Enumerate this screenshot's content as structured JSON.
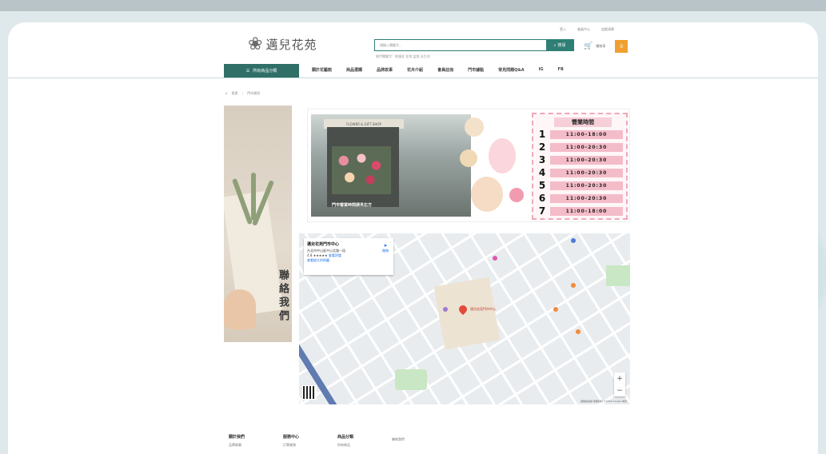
{
  "header": {
    "util_links": [
      "登入",
      "會員中心",
      "追蹤清單"
    ],
    "brand_name": "邁兒花苑",
    "search": {
      "placeholder": "請輸入關鍵字...",
      "button_label": "搜尋"
    },
    "hot_keywords": "熱門關鍵字：乾燥花 花束 盆栽 永生花",
    "cart": {
      "label": "購物車",
      "count": "0"
    }
  },
  "nav": {
    "category_button": "所有商品分類",
    "items": [
      "關於花藝館",
      "商品選購",
      "品牌故事",
      "花卉介紹",
      "會員註冊",
      "門市據點",
      "常見問題Q&A",
      "IG",
      "FB"
    ]
  },
  "breadcrumb": [
    "首頁",
    "門市資訊"
  ],
  "sidebanner": {
    "vertical_text": "聯絡我們"
  },
  "hours_banner": {
    "shop_sign": "FLOWER & GIFT SHOP",
    "caption": "門市營業時間請見右方",
    "title": "營業時間",
    "rows": [
      {
        "day": "1",
        "time": "11:00-18:00"
      },
      {
        "day": "2",
        "time": "11:00-20:30"
      },
      {
        "day": "3",
        "time": "11:00-20:30"
      },
      {
        "day": "4",
        "time": "11:00-20:30"
      },
      {
        "day": "5",
        "time": "11:00-20:30"
      },
      {
        "day": "6",
        "time": "11:00-20:30"
      },
      {
        "day": "7",
        "time": "11:00-18:00"
      }
    ]
  },
  "map": {
    "info_title": "邁兒花苑門市中心",
    "info_address": "台北市中山區中山北路一段",
    "info_rating": "4.8 ★★★★★",
    "info_reviews": "查看評論",
    "info_link": "查看放大的地圖",
    "directions_label": "路線",
    "pin_label": "邁兒花苑門市中心",
    "zoom_in": "+",
    "zoom_out": "−",
    "attribution": "鍵盤快速鍵 地圖資料 ©2024 Google 條款"
  },
  "footer": {
    "columns": [
      {
        "heading": "關於我們",
        "item": "品牌故事"
      },
      {
        "heading": "服務中心",
        "item": "訂單查詢"
      },
      {
        "heading": "商品分類",
        "item": "所有商品"
      },
      {
        "heading": "",
        "item": "聯絡我們"
      }
    ]
  },
  "colors": {
    "accent": "#2f7f76",
    "cart_badge": "#f0a030",
    "hours_pink": "#f4bcc8"
  }
}
